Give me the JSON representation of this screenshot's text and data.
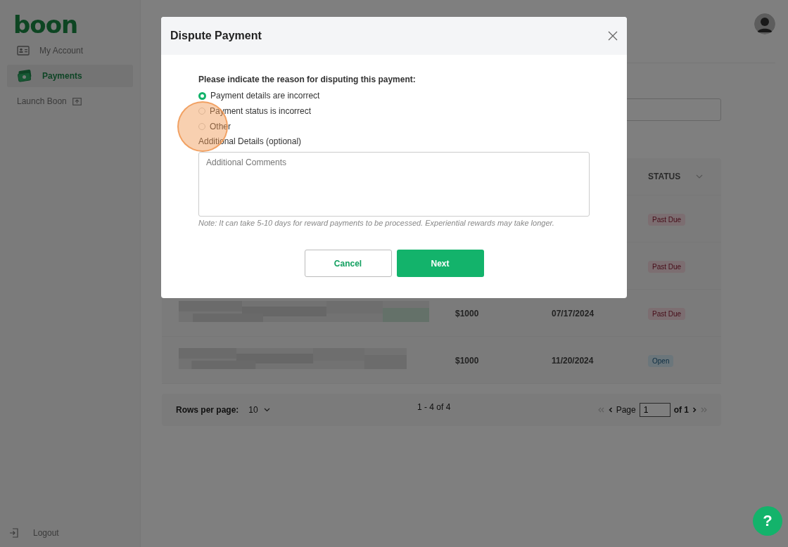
{
  "sidebar": {
    "logo": "boon",
    "items": [
      {
        "label": "My Account",
        "kind": "account",
        "selected": false
      },
      {
        "label": "Payments",
        "kind": "money",
        "selected": true
      },
      {
        "label": "Launch Boon",
        "kind": "launch",
        "selected": false
      }
    ],
    "logout": "Logout"
  },
  "table": {
    "columns": [
      {
        "label": "STATUS"
      }
    ],
    "rows": [
      {
        "status": "Past Due",
        "kind": "past_due"
      },
      {
        "status": "Past Due",
        "kind": "past_due"
      },
      {
        "amount": "$1000",
        "date": "07/17/2024",
        "status": "Past Due",
        "kind": "past_due"
      },
      {
        "amount": "$1000",
        "date": "11/20/2024",
        "status": "Open",
        "kind": "open"
      }
    ]
  },
  "pagination": {
    "rows_label": "Rows per page:",
    "rows_value": "10",
    "range": "1 - 4 of 4",
    "page_label": "Page",
    "page_value": "1",
    "of": "of 1"
  },
  "help": "?",
  "dialog": {
    "title": "Dispute Payment",
    "question": "Please indicate the reason for disputing this payment:",
    "options": [
      {
        "label": "Payment details are incorrect",
        "selected": true
      },
      {
        "label": "Payment status is incorrect",
        "selected": false
      },
      {
        "label": "Other",
        "selected": false
      }
    ],
    "details_label": "Additional Details (optional)",
    "placeholder": "Additional Comments",
    "note": "Note: It can take 5-10 days for reward payments to be processed. Experiential rewards may take longer.",
    "cancel": "Cancel",
    "next": "Next"
  }
}
